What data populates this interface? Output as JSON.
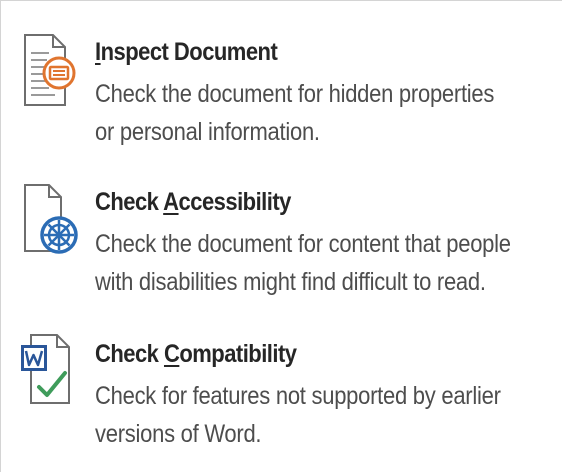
{
  "menu": {
    "items": [
      {
        "icon": "inspect-document-icon",
        "title_accel": "I",
        "title_rest": "nspect Document",
        "desc_line1": "Check the document for hidden properties",
        "desc_line2": "or personal information."
      },
      {
        "icon": "check-accessibility-icon",
        "title_pre": "Check ",
        "title_accel": "A",
        "title_rest": "ccessibility",
        "desc_line1": "Check the document for content that people",
        "desc_line2": "with disabilities might find difficult to read."
      },
      {
        "icon": "check-compatibility-icon",
        "title_pre": "Check ",
        "title_accel": "C",
        "title_rest": "ompatibility",
        "desc_line1": "Check for features not supported by earlier",
        "desc_line2": "versions of Word."
      }
    ]
  },
  "colors": {
    "title": "#262626",
    "description": "#4d4d4d",
    "icon_orange": "#e0752f",
    "icon_blue": "#2b6cb5",
    "icon_word_blue": "#2a5699",
    "icon_check_green": "#3f9c5b",
    "border": "#d4d4d4"
  }
}
